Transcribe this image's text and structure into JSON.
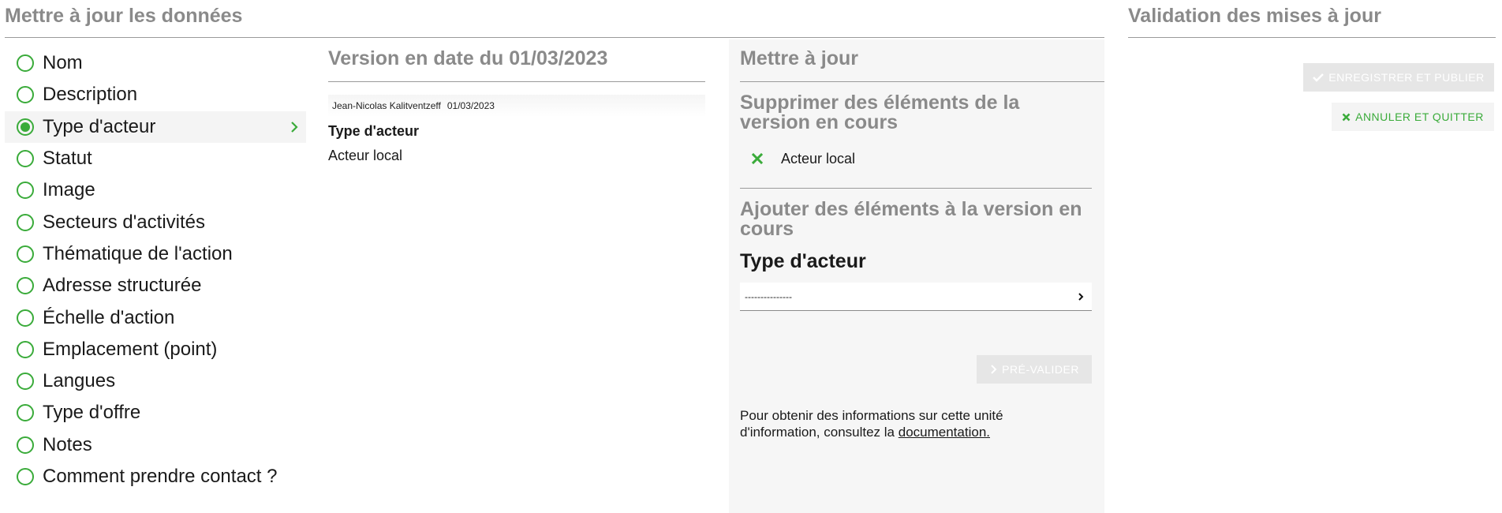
{
  "header": {
    "title": "Mettre à jour les données",
    "validation_title": "Validation des mises à jour"
  },
  "fields": [
    {
      "label": "Nom",
      "selected": false
    },
    {
      "label": "Description",
      "selected": false
    },
    {
      "label": "Type d'acteur",
      "selected": true
    },
    {
      "label": "Statut",
      "selected": false
    },
    {
      "label": "Image",
      "selected": false
    },
    {
      "label": "Secteurs d'activités",
      "selected": false
    },
    {
      "label": "Thématique de l'action",
      "selected": false
    },
    {
      "label": "Adresse structurée",
      "selected": false
    },
    {
      "label": "Échelle d'action",
      "selected": false
    },
    {
      "label": "Emplacement (point)",
      "selected": false
    },
    {
      "label": "Langues",
      "selected": false
    },
    {
      "label": "Type d'offre",
      "selected": false
    },
    {
      "label": "Notes",
      "selected": false
    },
    {
      "label": "Comment prendre contact ?",
      "selected": false
    }
  ],
  "version": {
    "title": "Version en date du 01/03/2023",
    "author": "Jean-Nicolas Kalitventzeff",
    "date": "01/03/2023",
    "field_label": "Type d'acteur",
    "field_value": "Acteur local"
  },
  "update": {
    "title": "Mettre à jour",
    "remove_title": "Supprimer des éléments de la version en cours",
    "remove_items": [
      "Acteur local"
    ],
    "add_title": "Ajouter des éléments à la version en cours",
    "add_field_label": "Type d'acteur",
    "select_value": "---------------",
    "prevalidate_label": "PRÉ-VALIDER",
    "help_prefix": "Pour obtenir des informations sur cette unité d'information, consultez la ",
    "help_link": "documentation."
  },
  "actions": {
    "publish_label": "ENREGISTRER ET PUBLIER",
    "cancel_label": "ANNULER ET QUITTER"
  },
  "colors": {
    "accent": "#3aab3a",
    "muted_title": "#8a8a8a",
    "panel_bg": "#f6f6f6"
  }
}
